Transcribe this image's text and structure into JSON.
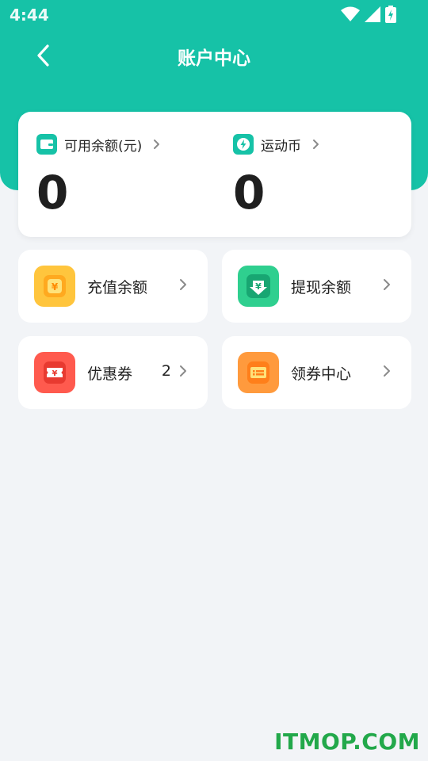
{
  "status_bar": {
    "time": "4:44"
  },
  "nav": {
    "title": "账户中心"
  },
  "balance": {
    "available_label": "可用余额(元)",
    "available_value": "0",
    "coins_label": "运动币",
    "coins_value": "0"
  },
  "tiles": {
    "recharge": {
      "label": "充值余额",
      "icon": "yuan-coin-icon",
      "color": "#ffc53d"
    },
    "withdraw": {
      "label": "提现余额",
      "icon": "yuan-download-icon",
      "color": "#2fcf8f"
    },
    "coupons": {
      "label": "优惠券",
      "count": "2",
      "icon": "yuan-ticket-icon",
      "color": "#ff5a4e"
    },
    "coupon_center": {
      "label": "领券中心",
      "icon": "coupon-list-icon",
      "color": "#ff9a3d"
    }
  },
  "watermark": "ITMOP.COM",
  "colors": {
    "brand": "#16c2a7",
    "background": "#f2f4f7"
  }
}
